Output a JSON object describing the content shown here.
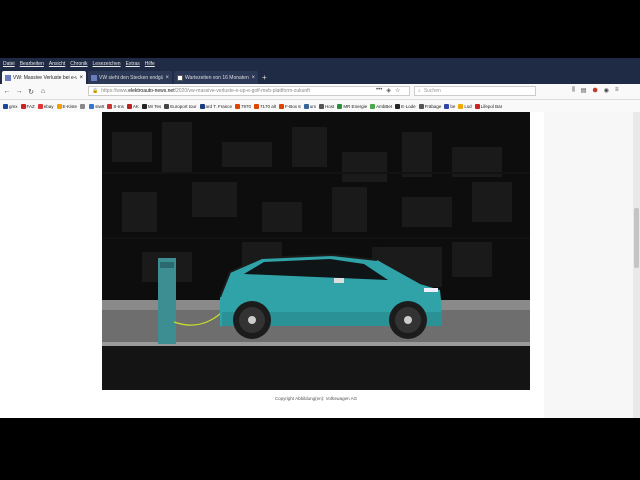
{
  "menu": [
    "Datei",
    "Bearbeiten",
    "Ansicht",
    "Chronik",
    "Lesezeichen",
    "Extras",
    "Hilfe"
  ],
  "tabs": [
    {
      "title": "VW: Massive Verluste bei e-up!",
      "active": true
    },
    {
      "title": "VW sieht den Stecken endgültig",
      "active": false
    },
    {
      "title": "Wartezeiten von 16 Monaten",
      "active": false
    }
  ],
  "tab_close": "×",
  "new_tab": "+",
  "nav": {
    "back": "←",
    "forward": "→",
    "reload": "↻",
    "home": "⌂"
  },
  "address": {
    "prefix": "https://www.",
    "domain": "elektroauto-news.net",
    "path": "/2020/vw-massive-verluste-e-up-e-golf-meb-plattform-zukunft"
  },
  "search_placeholder": "Suchen",
  "bookmarks": [
    {
      "label": "gmx",
      "color": "#1c449b"
    },
    {
      "label": "FAZ",
      "color": "#cc2222"
    },
    {
      "label": "ebay",
      "color": "#e53238"
    },
    {
      "label": "E-Kiste",
      "color": "#f0a000"
    },
    {
      "label": "",
      "color": "#888888"
    },
    {
      "label": "stwtt",
      "color": "#3377cc"
    },
    {
      "label": "S-Ins",
      "color": "#cc3333"
    },
    {
      "label": "AK",
      "color": "#bb2222"
    },
    {
      "label": "Mr Tes",
      "color": "#222222"
    },
    {
      "label": "Europort tour",
      "color": "#444444"
    },
    {
      "label": "ard T. France",
      "color": "#1a3c7a"
    },
    {
      "label": "7970",
      "color": "#dd4400"
    },
    {
      "label": "7170 alt",
      "color": "#dd4400"
    },
    {
      "label": "F-Box 6",
      "color": "#dd4400"
    },
    {
      "label": "urx",
      "color": "#336699"
    },
    {
      "label": "Host",
      "color": "#555555"
    },
    {
      "label": "MR Energie",
      "color": "#2a8f3a"
    },
    {
      "label": "AmbBet",
      "color": "#4aa84a"
    },
    {
      "label": "E-Lode",
      "color": "#222222"
    },
    {
      "label": "Fräbage",
      "color": "#555555"
    },
    {
      "label": "be",
      "color": "#3344aa"
    },
    {
      "label": "Lsd",
      "color": "#eeaa00"
    },
    {
      "label": "Lifepol Bat",
      "color": "#cc2222"
    }
  ],
  "caption": "Copyright Abbildung(en): Volkswagen AG",
  "colors": {
    "chrome": "#1f2a44",
    "car": "#2fa3a8"
  }
}
